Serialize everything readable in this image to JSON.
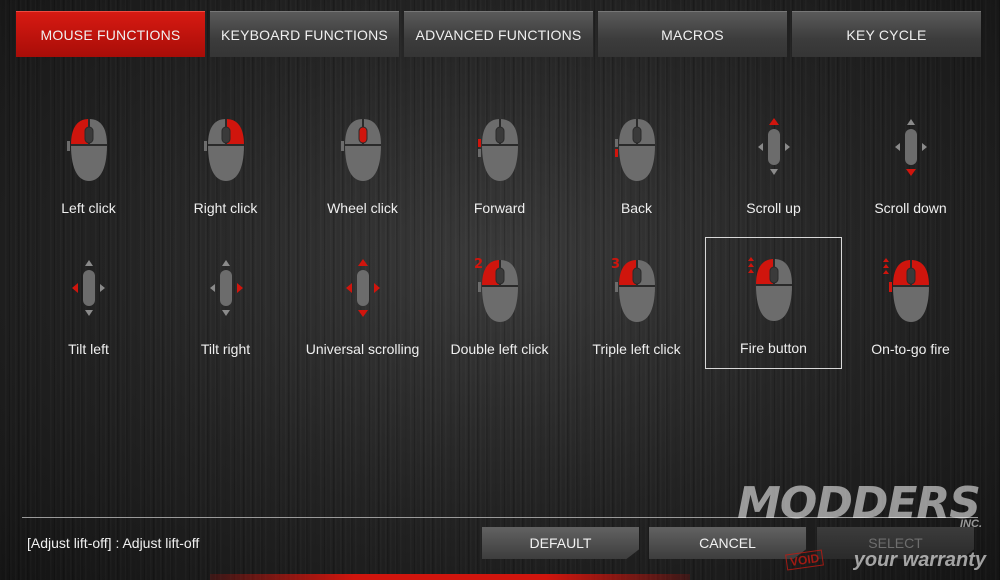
{
  "tabs": [
    {
      "label": "MOUSE FUNCTIONS",
      "active": true
    },
    {
      "label": "KEYBOARD FUNCTIONS",
      "active": false
    },
    {
      "label": "ADVANCED FUNCTIONS",
      "active": false
    },
    {
      "label": "MACROS",
      "active": false
    },
    {
      "label": "KEY CYCLE",
      "active": false
    }
  ],
  "functions": {
    "row1": [
      {
        "label": "Left click",
        "icon": "mouse-left-click-icon"
      },
      {
        "label": "Right click",
        "icon": "mouse-right-click-icon"
      },
      {
        "label": "Wheel click",
        "icon": "mouse-wheel-click-icon"
      },
      {
        "label": "Forward",
        "icon": "mouse-forward-icon"
      },
      {
        "label": "Back",
        "icon": "mouse-back-icon"
      },
      {
        "label": "Scroll up",
        "icon": "scroll-up-icon"
      },
      {
        "label": "Scroll down",
        "icon": "scroll-down-icon"
      }
    ],
    "row2": [
      {
        "label": "Tilt left",
        "icon": "tilt-left-icon"
      },
      {
        "label": "Tilt right",
        "icon": "tilt-right-icon"
      },
      {
        "label": "Universal scrolling",
        "icon": "universal-scrolling-icon"
      },
      {
        "label": "Double left click",
        "icon": "double-left-click-icon",
        "badge": "2"
      },
      {
        "label": "Triple left click",
        "icon": "triple-left-click-icon",
        "badge": "3"
      },
      {
        "label": "Fire button",
        "icon": "fire-button-icon",
        "selected": true
      },
      {
        "label": "On-to-go fire",
        "icon": "on-to-go-fire-icon"
      }
    ]
  },
  "status_text": "[Adjust lift-off] : Adjust lift-off",
  "buttons": {
    "default_label": "DEFAULT",
    "cancel_label": "CANCEL",
    "select_label": "SELECT"
  },
  "watermark": {
    "logo": "MODDERS",
    "inc": "INC.",
    "void": "VOID",
    "warranty": "your warranty"
  },
  "colors": {
    "accent_red": "#d0150d",
    "mouse_gray": "#6c6c6c"
  }
}
